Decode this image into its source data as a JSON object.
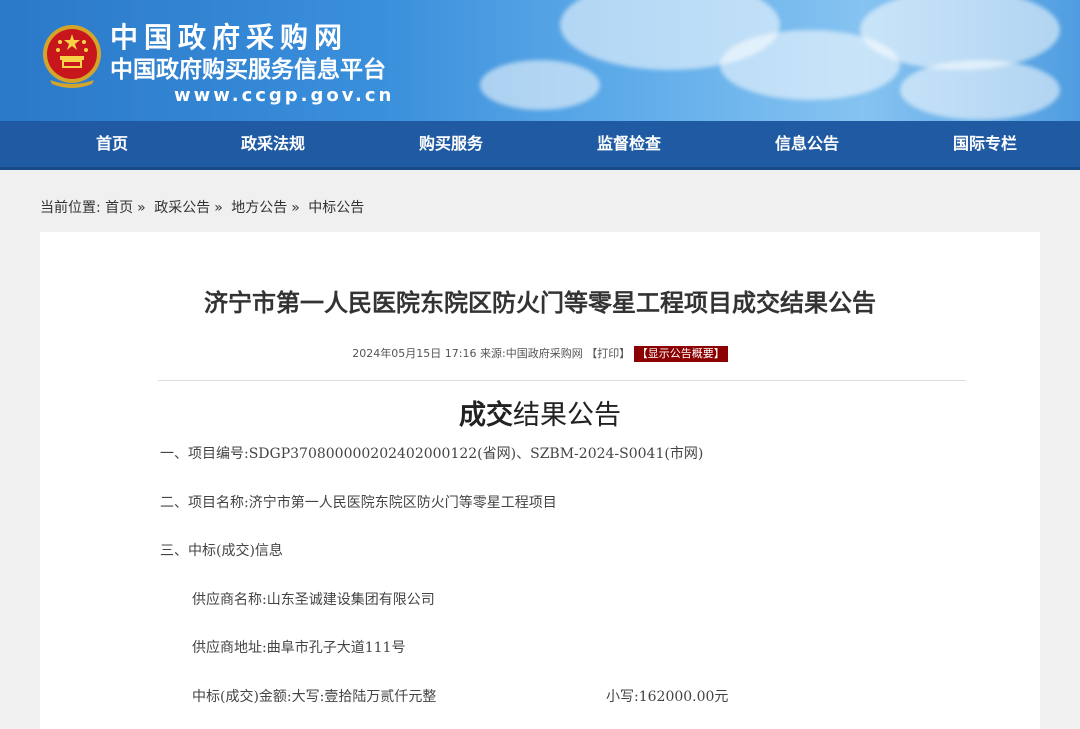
{
  "header": {
    "site_name": "中国政府采购网",
    "site_subtitle": "中国政府购买服务信息平台",
    "site_url": "www.ccgp.gov.cn",
    "emblem_icon": "national-emblem-icon"
  },
  "nav": {
    "items": [
      {
        "label": "首页"
      },
      {
        "label": "政采法规"
      },
      {
        "label": "购买服务"
      },
      {
        "label": "监督检查"
      },
      {
        "label": "信息公告"
      },
      {
        "label": "国际专栏"
      }
    ]
  },
  "breadcrumb": {
    "prefix": "当前位置:",
    "items": [
      {
        "label": "首页"
      },
      {
        "label": "政采公告"
      },
      {
        "label": "地方公告"
      },
      {
        "label": "中标公告"
      }
    ],
    "separator": "»"
  },
  "article": {
    "title": "济宁市第一人民医院东院区防火门等零星工程项目成交结果公告",
    "meta": {
      "datetime": "2024年05月15日 17:16",
      "source_label": "来源:",
      "source": "中国政府采购网",
      "print": "【打印】",
      "summary": "【显示公告概要】"
    },
    "doc_title_bold": "成交",
    "doc_title_rest": "结果公告",
    "lines": [
      "一、项目编号:SDGP370800000202402000122(省网)、SZBM-2024-S0041(市网)",
      "二、项目名称:济宁市第一人民医院东院区防火门等零星工程项目",
      "三、中标(成交)信息",
      "供应商名称:山东圣诚建设集团有限公司",
      "供应商地址:曲阜市孔子大道111号",
      "中标(成交)金额:大写:壹拾陆万贰仟元整"
    ],
    "amount_small": "小写:162000.00元"
  },
  "colors": {
    "nav_bg": "#1f5aa3",
    "banner_blue": "#2a79c9",
    "summary_btn_bg": "#8b0000",
    "page_bg": "#f0f0f0"
  }
}
